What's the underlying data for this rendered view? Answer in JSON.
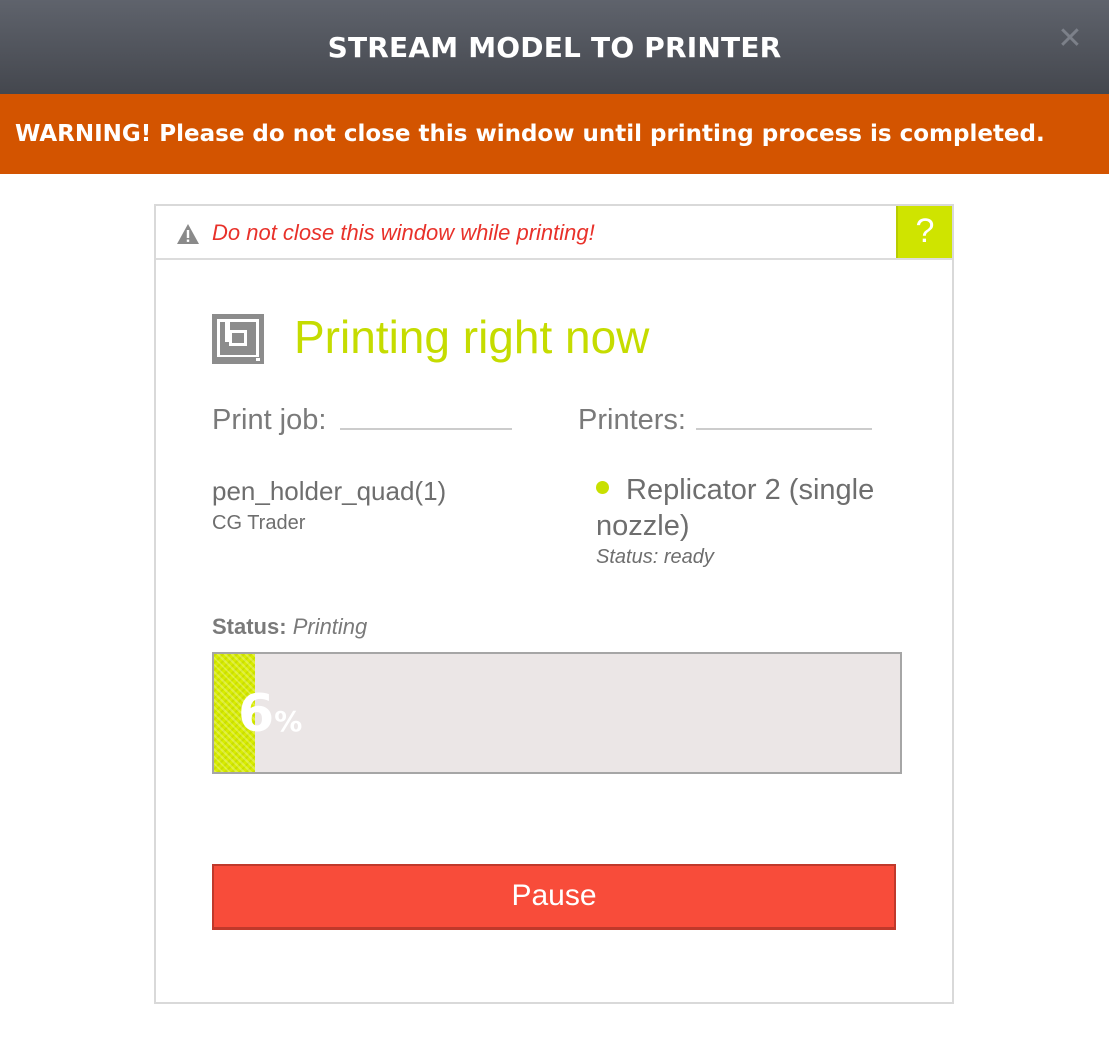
{
  "window": {
    "title": "STREAM MODEL TO PRINTER",
    "close_icon": "close-icon"
  },
  "warning_bar": {
    "text": "WARNING! Please do not close this window until printing process is completed."
  },
  "panel": {
    "alert_icon": "warning-triangle-icon",
    "alert_text": "Do not close this window while printing!",
    "help_label": "?",
    "printer_icon": "printer-icon",
    "heading": "Printing right now",
    "print_job": {
      "label": "Print job:",
      "name": "pen_holder_quad(1)",
      "source": "CG Trader"
    },
    "printers": {
      "label": "Printers:",
      "items": [
        {
          "name": "Replicator 2 (single nozzle)",
          "status": "Status: ready",
          "dot_color": "#c8e000"
        }
      ]
    },
    "status": {
      "label": "Status:",
      "value": "Printing"
    },
    "progress": {
      "value": 6,
      "percent_sign": "%"
    },
    "pause_label": "Pause"
  },
  "colors": {
    "accent_green": "#c8e000",
    "warning_orange": "#d35400",
    "alert_red": "#e8312a",
    "button_red": "#f84c3a"
  }
}
